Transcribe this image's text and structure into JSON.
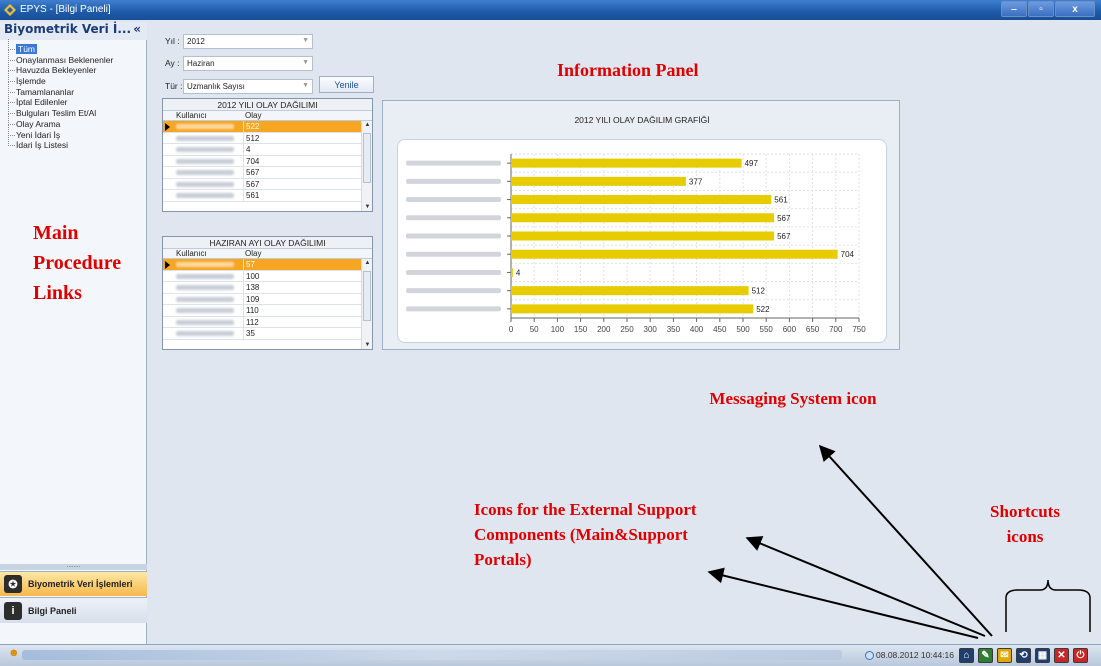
{
  "window": {
    "title": "EPYS - [Bilgi Paneli]",
    "btn_min": "–",
    "btn_max": "▫",
    "btn_close": "x"
  },
  "sidebar": {
    "header": "Biyometrik Veri İ...",
    "collapse": "«",
    "items": [
      {
        "label": "Tüm"
      },
      {
        "label": "Onaylanması Beklenenler"
      },
      {
        "label": "Havuzda Bekleyenler"
      },
      {
        "label": "İşlemde"
      },
      {
        "label": "Tamamlananlar"
      },
      {
        "label": "İptal Edilenler"
      },
      {
        "label": "Bulguları Teslim Et/Al"
      },
      {
        "label": "Olay Arama"
      },
      {
        "label": "Yeni İdari İş"
      },
      {
        "label": "İdari İş Listesi"
      }
    ],
    "splitter": "........",
    "nav_active": "Biyometrik Veri İşlemleri",
    "nav_info": "Bilgi Paneli"
  },
  "annotations": {
    "main_links": "Main Procedure Links",
    "info_panel": "Information Panel",
    "messaging": "Messaging System icon",
    "external": "Icons for the External Support Components (Main&Support Portals)",
    "shortcuts": "Shortcuts icons"
  },
  "filters": {
    "year_label": "Yıl :",
    "year_value": "2012",
    "month_label": "Ay :",
    "month_value": "Haziran",
    "type_label": "Tür :",
    "type_value": "Uzmanlık Sayısı",
    "refresh": "Yenile"
  },
  "grid_year": {
    "title": "2012 YILI OLAY DAĞILIMI",
    "col_user": "Kullanıcı",
    "col_count": "Olay",
    "values": [
      "522",
      "512",
      "4",
      "704",
      "567",
      "567",
      "561"
    ]
  },
  "grid_month": {
    "title": "HAZIRAN AYI OLAY DAĞILIMI",
    "col_user": "Kullanıcı",
    "col_count": "Olay",
    "values": [
      "57",
      "100",
      "138",
      "109",
      "110",
      "112",
      "35"
    ]
  },
  "chart_data": {
    "type": "bar",
    "orientation": "horizontal",
    "title": "2012 YILI OLAY DAĞILIM GRAFİĞİ",
    "values": [
      497,
      377,
      561,
      567,
      567,
      704,
      4,
      512,
      522
    ],
    "xlim": [
      0,
      750
    ],
    "xticks": [
      0,
      50,
      100,
      150,
      200,
      250,
      300,
      350,
      400,
      450,
      500,
      550,
      600,
      650,
      700,
      750
    ],
    "bar_color": "#e6cc00",
    "grid": true
  },
  "status": {
    "datetime": "08.08.2012 10:44:16"
  },
  "icons": {
    "status_bar": [
      "home-icon",
      "support-portal-icon",
      "messaging-icon",
      "refresh-icon",
      "shortcut-icon",
      "close-red-icon",
      "power-icon"
    ]
  }
}
